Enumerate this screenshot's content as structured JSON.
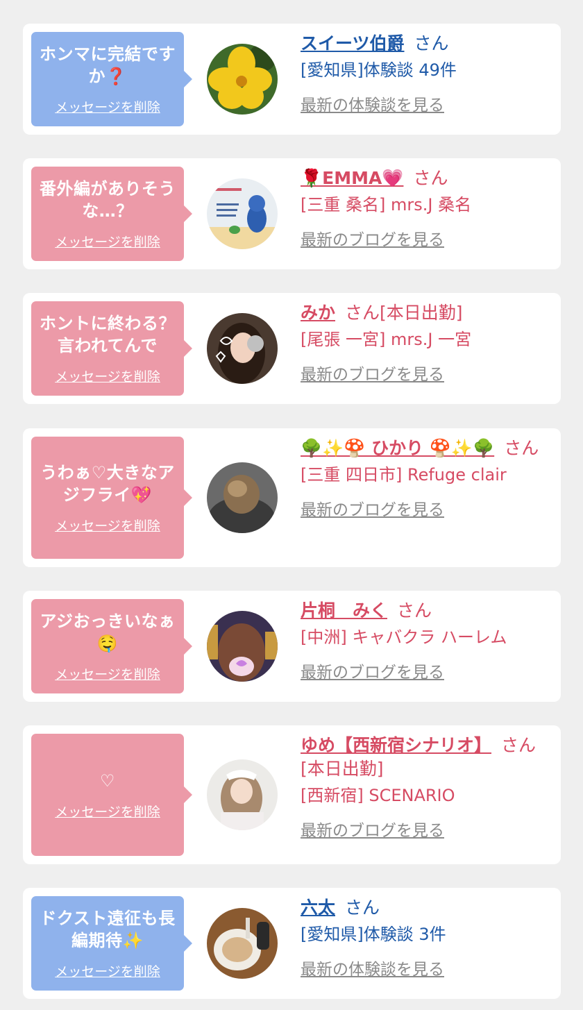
{
  "cards": [
    {
      "message": "ホンマに完結ですか❓",
      "delete_label": "メッセージを削除",
      "name": "スイーツ伯爵",
      "suffix": "さん",
      "location": "[愛知県]体験談 49件",
      "latest": "最新の体験談を見る",
      "theme": "blue"
    },
    {
      "message": "番外編がありそうな…？",
      "delete_label": "メッセージを削除",
      "name": "🌹EMMA💗",
      "suffix": "さん",
      "location": "[三重 桑名] mrs.J 桑名",
      "latest": "最新のブログを見る",
      "theme": "pink"
    },
    {
      "message": "ホントに終わる？言われてんで",
      "delete_label": "メッセージを削除",
      "name": "みか",
      "suffix": "さん[本日出勤]",
      "location": "[尾張 一宮] mrs.J 一宮",
      "latest": "最新のブログを見る",
      "theme": "pink"
    },
    {
      "message": "うわぁ♡大きなアジフライ💖",
      "delete_label": "メッセージを削除",
      "name": "🌳✨🍄 ひかり 🍄✨🌳",
      "suffix": "さん",
      "location": "[三重 四日市] Refuge clair",
      "latest": "最新のブログを見る",
      "theme": "pink"
    },
    {
      "message": "アジおっきいなぁ🤤",
      "delete_label": "メッセージを削除",
      "name": "片桐　みく",
      "suffix": "さん",
      "location": "[中洲] キャバクラ ハーレム",
      "latest": "最新のブログを見る",
      "theme": "pink"
    },
    {
      "message": "♡",
      "delete_label": "メッセージを削除",
      "name": "ゆめ【西新宿シナリオ】",
      "suffix": "さん[本日出勤]",
      "location": "[西新宿] SCENARIO",
      "latest": "最新のブログを見る",
      "theme": "pink"
    },
    {
      "message": "ドクスト遠征も長編期待✨",
      "delete_label": "メッセージを削除",
      "name": "六太",
      "suffix": "さん",
      "location": "[愛知県]体験談 3件",
      "latest": "最新の体験談を見る",
      "theme": "blue"
    }
  ],
  "colors": {
    "blue_bubble": "#8fb2ec",
    "pink_bubble": "#ec9aa8",
    "blue_text": "#1f5aa8",
    "pink_text": "#d64b63",
    "link_gray": "#8a8a8a"
  }
}
